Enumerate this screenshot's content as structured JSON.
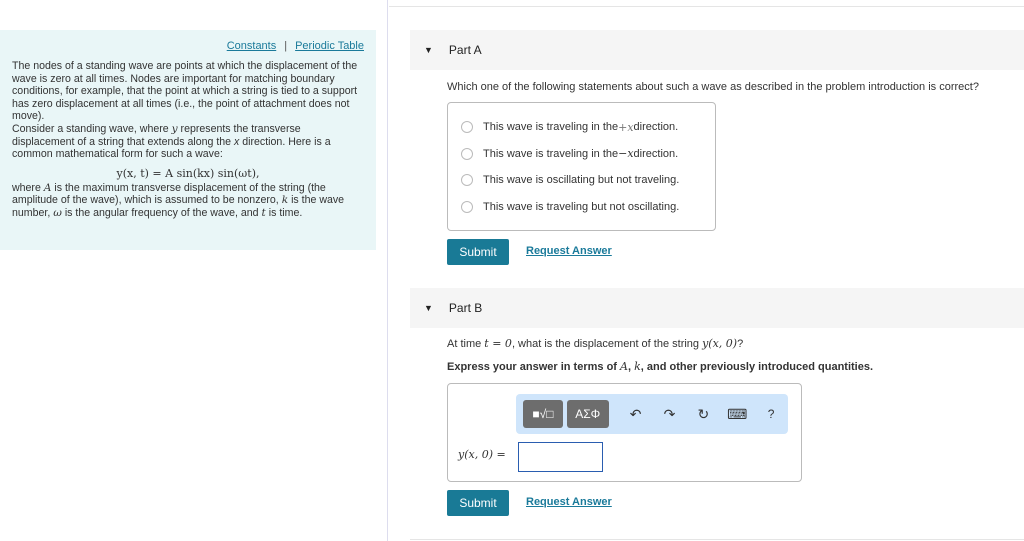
{
  "left": {
    "links": {
      "constants": "Constants",
      "separator": "|",
      "periodic_table": "Periodic Table"
    },
    "intro_p1": "The nodes of a standing wave are points at which the displacement of the wave is zero at all times. Nodes are important for matching boundary conditions, for example, that the point at which a string is tied to a support has zero displacement at all times (i.e., the point of attachment does not move).",
    "intro_p2_a": "Consider a standing wave, where ",
    "intro_p2_y": "y",
    "intro_p2_b": " represents the transverse displacement of a string that extends along the ",
    "intro_p2_x": "x",
    "intro_p2_c": " direction. Here is a common mathematical form for such a wave:",
    "equation": "y(x, t) = A sin(kx) sin(ωt),",
    "p3_a": "where ",
    "p3_A": "A",
    "p3_b": " is the maximum transverse displacement of the string (the amplitude of the wave), which is assumed to be nonzero, ",
    "p3_k": "k",
    "p3_c": " is the wave number, ",
    "p3_w": "ω",
    "p3_d": " is the angular frequency of the wave, and ",
    "p3_t": "t",
    "p3_e": " is time."
  },
  "partA": {
    "title": "Part A",
    "question": "Which one of the following statements about such a wave as described in the problem introduction is correct?",
    "options": [
      {
        "pre": "This wave is traveling in the ",
        "math": "+x",
        "post": " direction."
      },
      {
        "pre": "This wave is traveling in the ",
        "math": "−x",
        "post": " direction."
      },
      {
        "pre": "This wave is oscillating but not traveling.",
        "math": "",
        "post": ""
      },
      {
        "pre": "This wave is traveling but not oscillating.",
        "math": "",
        "post": ""
      }
    ],
    "submit": "Submit",
    "request": "Request Answer"
  },
  "partB": {
    "title": "Part B",
    "q_a": "At time ",
    "q_t": "t = 0",
    "q_b": ", what is the displacement of the string ",
    "q_y": "y(x, 0)",
    "q_c": "?",
    "inst_a": "Express your answer in terms of ",
    "inst_A": "A",
    "inst_b": ", ",
    "inst_k": "k",
    "inst_c": ", and other previously introduced quantities.",
    "toolbar": {
      "templates": "■√□",
      "greek": "ΑΣΦ",
      "undo": "↶",
      "redo": "↷",
      "reset": "↻",
      "keyboard": "⌨",
      "help": "?"
    },
    "answer_label": "y(x, 0) =",
    "answer_value": "",
    "submit": "Submit",
    "request": "Request Answer"
  }
}
